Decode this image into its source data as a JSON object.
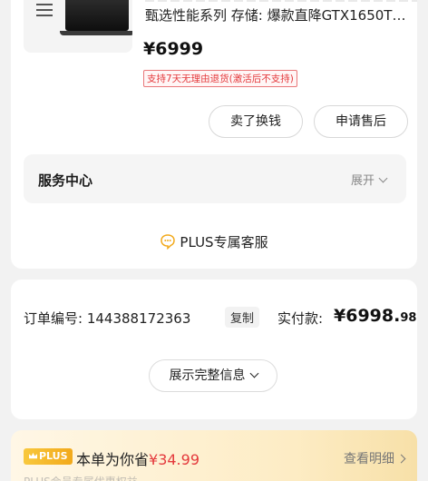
{
  "product": {
    "title": "甄选性能系列  存储: 爆款直降GTX1650T…",
    "price": "¥6999",
    "return_tag": "支持7天无理由退货(激活后不支持)"
  },
  "actions": {
    "sell_label": "卖了换钱",
    "after_sale_label": "申请售后"
  },
  "service": {
    "label": "服务中心",
    "toggle": "展开"
  },
  "plus_service": {
    "label": "PLUS专属客服"
  },
  "order": {
    "number_label": "订单编号:",
    "number": "144388172363",
    "copy_label": "复制",
    "paid_label": "实付款:",
    "paid_int": "¥6998.",
    "paid_dec": "98",
    "show_all_label": "展示完整信息"
  },
  "plus_banner": {
    "badge": "PLUS",
    "save_prefix": "本单为你省",
    "save_amount": "¥34.99",
    "detail_label": "查看明细",
    "sub": "PLUS会员专属优惠权益"
  },
  "colors": {
    "accent_red": "#e4393c",
    "plus_gold": "#f2a91b"
  }
}
